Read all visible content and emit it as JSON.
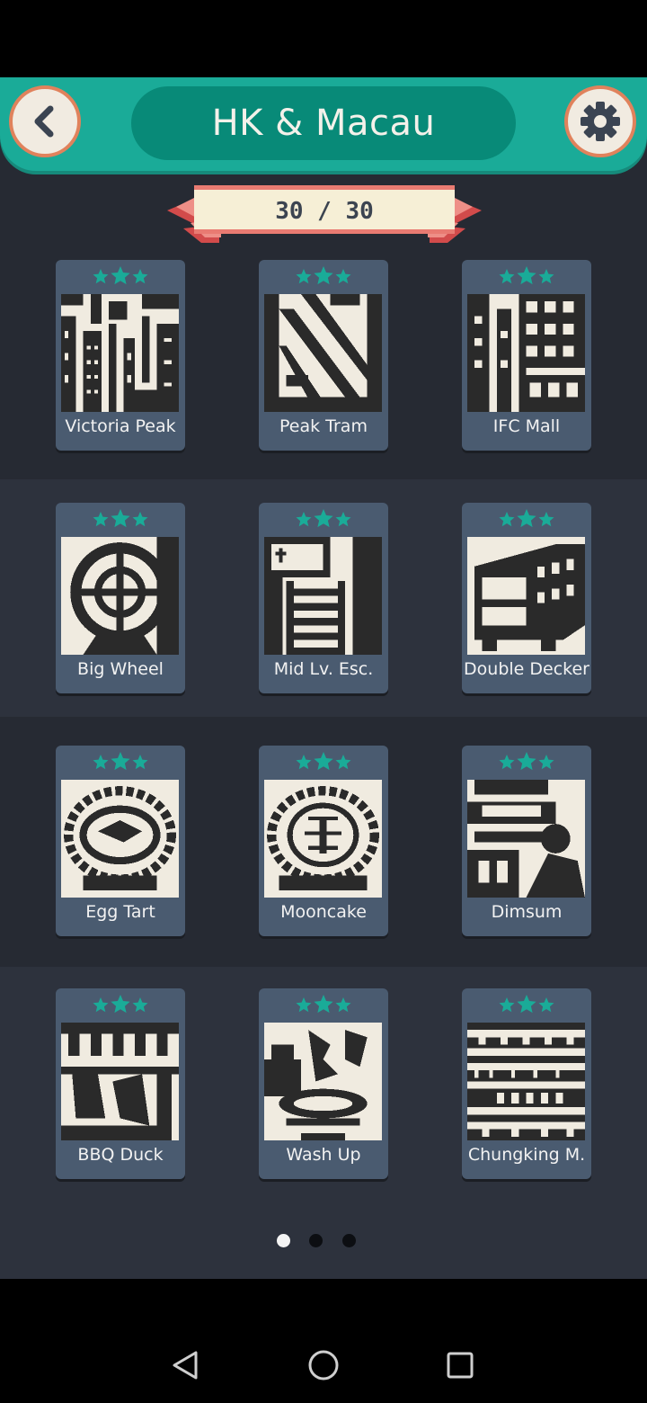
{
  "header": {
    "back_icon": "chevron-left-icon",
    "title": "HK & Macau",
    "settings_icon": "gear-icon"
  },
  "progress": {
    "label": "30 / 30",
    "completed": 30,
    "total": 30
  },
  "levels": [
    {
      "name": "Victoria Peak",
      "stars": 3
    },
    {
      "name": "Peak Tram",
      "stars": 3
    },
    {
      "name": "IFC Mall",
      "stars": 3
    },
    {
      "name": "Big Wheel",
      "stars": 3
    },
    {
      "name": "Mid Lv. Esc.",
      "stars": 3
    },
    {
      "name": "Double Decker",
      "stars": 3
    },
    {
      "name": "Egg Tart",
      "stars": 3
    },
    {
      "name": "Mooncake",
      "stars": 3
    },
    {
      "name": "Dimsum",
      "stars": 3
    },
    {
      "name": "BBQ Duck",
      "stars": 3
    },
    {
      "name": "Wash Up",
      "stars": 3
    },
    {
      "name": "Chungking M.",
      "stars": 3
    }
  ],
  "pager": {
    "pages": 3,
    "current": 1
  },
  "navbar": {
    "back": "triangle-back-icon",
    "home": "circle-home-icon",
    "recents": "square-recents-icon"
  },
  "colors": {
    "header": "#1aab98",
    "title_pill": "#088a78",
    "star": "#1aab98",
    "card": "#4a5b70",
    "accent_ring": "#e0825c"
  }
}
